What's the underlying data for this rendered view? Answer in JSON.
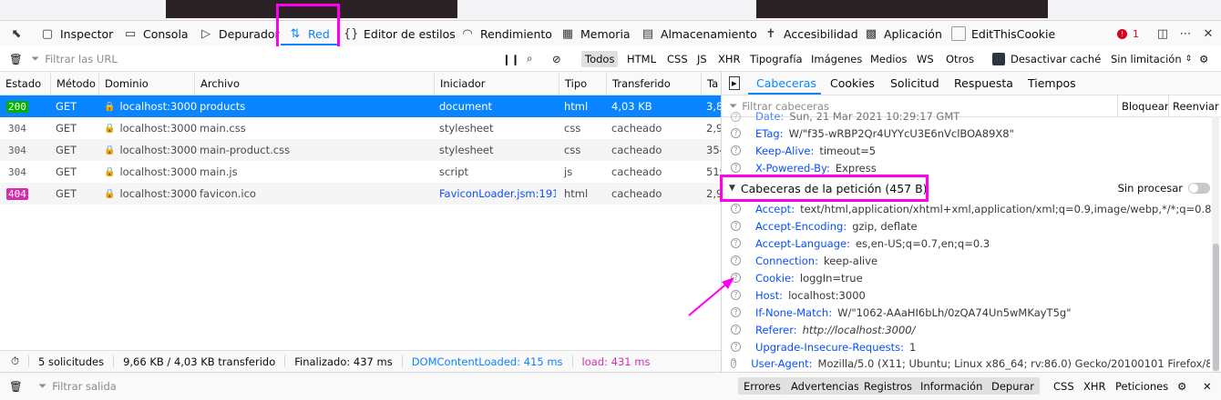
{
  "toolbar": {
    "tools": [
      {
        "label": "Inspector",
        "icon": "inspector-icon"
      },
      {
        "label": "Consola",
        "icon": "console-icon"
      },
      {
        "label": "Depurador",
        "icon": "debugger-icon"
      },
      {
        "label": "Red",
        "icon": "network-icon"
      },
      {
        "label": "Editor de estilos",
        "icon": "style-editor-icon"
      },
      {
        "label": "Rendimiento",
        "icon": "performance-icon"
      },
      {
        "label": "Memoria",
        "icon": "memory-icon"
      },
      {
        "label": "Almacenamiento",
        "icon": "storage-icon"
      },
      {
        "label": "Accesibilidad",
        "icon": "accessibility-icon"
      },
      {
        "label": "Aplicación",
        "icon": "application-icon"
      },
      {
        "label": "EditThisCookie",
        "icon": "cookie-icon"
      }
    ],
    "selected": "Red",
    "error_count": "1"
  },
  "filter": {
    "placeholder": "Filtrar las URL",
    "types": [
      "Todos",
      "HTML",
      "CSS",
      "JS",
      "XHR",
      "Tipografía",
      "Imágenes",
      "Medios",
      "WS",
      "Otros"
    ],
    "active_type": "Todos",
    "disable_cache_label": "Desactivar caché",
    "throttling": "Sin limitación"
  },
  "table": {
    "columns": [
      "Estado",
      "Método",
      "Dominio",
      "Archivo",
      "Iniciador",
      "Tipo",
      "Transferido",
      "Ta"
    ],
    "rows": [
      {
        "status": "200",
        "method": "GET",
        "domain": "localhost:3000",
        "file": "products",
        "initiator": "document",
        "type": "html",
        "transferred": "4,03 KB",
        "size": "3,8"
      },
      {
        "status": "304",
        "method": "GET",
        "domain": "localhost:3000",
        "file": "main.css",
        "initiator": "stylesheet",
        "type": "css",
        "transferred": "cacheado",
        "size": "2,9"
      },
      {
        "status": "304",
        "method": "GET",
        "domain": "localhost:3000",
        "file": "main-product.css",
        "initiator": "stylesheet",
        "type": "css",
        "transferred": "cacheado",
        "size": "354"
      },
      {
        "status": "304",
        "method": "GET",
        "domain": "localhost:3000",
        "file": "main.js",
        "initiator": "script",
        "type": "js",
        "transferred": "cacheado",
        "size": "519"
      },
      {
        "status": "404",
        "method": "GET",
        "domain": "localhost:3000",
        "file": "favicon.ico",
        "initiator": "FaviconLoader.jsm:191…",
        "type": "html",
        "transferred": "cacheado",
        "size": "2,9"
      }
    ]
  },
  "status_bar": {
    "requests": "5 solicitudes",
    "transferred": "9,66 KB / 4,03 KB transferido",
    "finished": "Finalizado: 437 ms",
    "dom_loaded": "DOMContentLoaded: 415 ms",
    "load": "load: 431 ms"
  },
  "details": {
    "tabs": [
      "Cabeceras",
      "Cookies",
      "Solicitud",
      "Respuesta",
      "Tiempos"
    ],
    "active_tab": "Cabeceras",
    "filter_placeholder": "Filtrar cabeceras",
    "block_label": "Bloquear",
    "resend_label": "Reenviar",
    "response_headers": [
      {
        "name": "Date:",
        "value": "Sun, 21 Mar 2021 10:29:17 GMT"
      },
      {
        "name": "ETag:",
        "value": "W/\"f35-wRBP2Qr4UYYcU3E6nVclBOA89X8\""
      },
      {
        "name": "Keep-Alive:",
        "value": "timeout=5"
      },
      {
        "name": "X-Powered-By:",
        "value": "Express"
      }
    ],
    "request_section_title": "Cabeceras de la petición (457 B)",
    "raw_label": "Sin procesar",
    "request_headers": [
      {
        "name": "Accept:",
        "value": "text/html,application/xhtml+xml,application/xml;q=0.9,image/webp,*/*;q=0.8"
      },
      {
        "name": "Accept-Encoding:",
        "value": "gzip, deflate"
      },
      {
        "name": "Accept-Language:",
        "value": "es,en-US;q=0.7,en;q=0.3"
      },
      {
        "name": "Connection:",
        "value": "keep-alive"
      },
      {
        "name": "Cookie:",
        "value": "loggIn=true"
      },
      {
        "name": "Host:",
        "value": "localhost:3000"
      },
      {
        "name": "If-None-Match:",
        "value": "W/\"1062-AAaHI6bLh/0zQA74Un5wMKayT5g\""
      },
      {
        "name": "Referer:",
        "value": "http://localhost:3000/"
      },
      {
        "name": "Upgrade-Insecure-Requests:",
        "value": "1"
      },
      {
        "name": "User-Agent:",
        "value": "Mozilla/5.0 (X11; Ubuntu; Linux x86_64; rv:86.0) Gecko/20100101 Firefox/86.0"
      }
    ]
  },
  "console": {
    "placeholder": "Filtrar salida",
    "levels": [
      "Errores",
      "Advertencias",
      "Registros",
      "Información",
      "Depurar"
    ],
    "types": [
      "CSS",
      "XHR",
      "Peticiones"
    ]
  },
  "colors": {
    "accent": "#0a84ff",
    "highlight": "#ff00ee",
    "status_ok": "#058b00",
    "status_not_found": "#d12fb0",
    "header_name": "#0a4ffe"
  }
}
